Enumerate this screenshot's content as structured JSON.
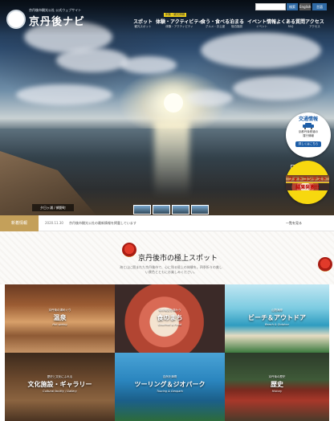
{
  "header": {
    "logo_small": "京丹後市観光公社 公式ウェブサイト",
    "logo_title": "京丹後ナビ",
    "search_placeholder": "",
    "top_buttons": [
      "検索",
      "English",
      "言語"
    ]
  },
  "nav": {
    "badge": "体験・観光情報",
    "items": [
      {
        "label": "スポット",
        "sub": "観光スポット"
      },
      {
        "label": "体験・アクティビティ",
        "sub": "体験・アクティビティ"
      },
      {
        "label": "食う・食べる",
        "sub": "グルメ・お土産"
      },
      {
        "label": "泊まる",
        "sub": "宿泊施設"
      },
      {
        "label": "イベント情報",
        "sub": "イベント"
      },
      {
        "label": "よくある質問",
        "sub": "FAQ"
      },
      {
        "label": "アクセス",
        "sub": "アクセス"
      }
    ]
  },
  "hero": {
    "caption": "夕日ヶ浦 / 網野町",
    "traffic": {
      "title": "交通情報",
      "desc1": "京都丹後鉄道の",
      "desc2": "運行情報",
      "button": "詳しくはこちら"
    },
    "contest": {
      "line1": "フォトコンテスト",
      "line2": "結果発表!!"
    }
  },
  "news": {
    "label": "新着情報",
    "date": "2020.11.30",
    "text": "京丹後市観光公社の最新情報を掲載しています",
    "list_link": "一覧を見る"
  },
  "best": {
    "title": "京丹後市の極上スポット",
    "desc": "海と山に囲まれた京丹後市で、心に残る極上の体験を。四季折々の美しい景色とともにお楽しみください。"
  },
  "tiles": [
    {
      "small": "京丹後の湯めぐり",
      "label": "温泉",
      "en": "Hot spring"
    },
    {
      "small": "旬の味覚を味わう",
      "label": "食のまち",
      "en": "Gourmet & Food"
    },
    {
      "small": "山陰海岸",
      "label": "ビーチ＆アウトドア",
      "en": "Beach & Outdoor"
    },
    {
      "small": "歴史と文化にふれる",
      "label": "文化施設・ギャラリー",
      "en": "Cultural facility / Gallery"
    },
    {
      "small": "自然を満喫",
      "label": "ツーリング＆ジオパーク",
      "en": "Touring & Geopark"
    },
    {
      "small": "京丹後の歴史",
      "label": "歴史",
      "en": "History"
    }
  ]
}
